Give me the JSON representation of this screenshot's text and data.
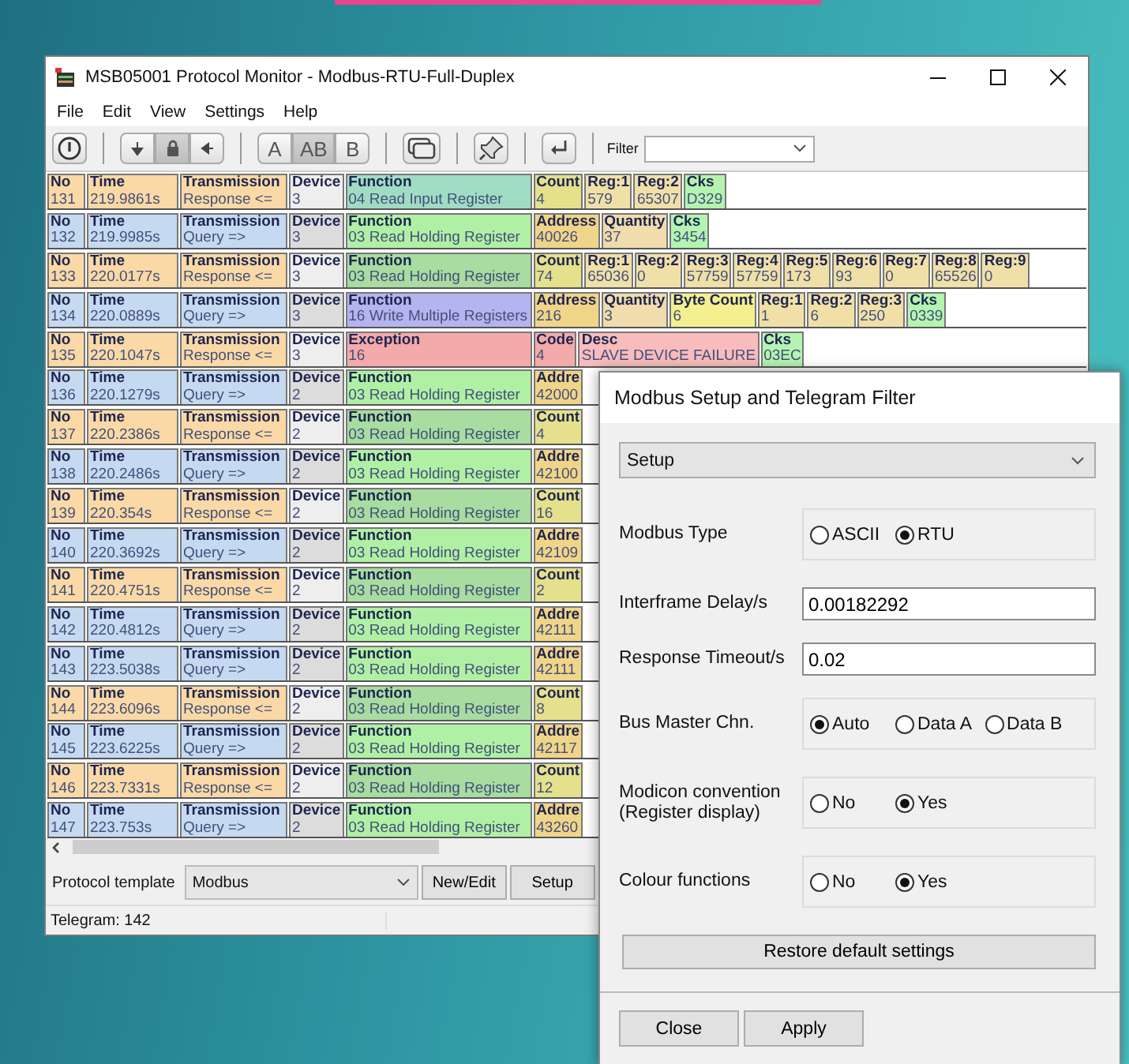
{
  "window": {
    "title": "MSB05001 Protocol Monitor - Modbus-RTU-Full-Duplex",
    "menu": [
      "File",
      "Edit",
      "View",
      "Settings",
      "Help"
    ],
    "toolbar": {
      "scroll_buttons": [
        {
          "selected": false
        },
        {
          "selected": true
        },
        {
          "selected": false
        }
      ],
      "view_buttons": [
        {
          "label": "A",
          "selected": false
        },
        {
          "label": "AB",
          "selected": true
        },
        {
          "label": "B",
          "selected": false
        }
      ],
      "filter_label": "Filter"
    }
  },
  "telegrams": [
    {
      "cells": [
        {
          "label": "No",
          "value": "131",
          "color": "#fad9a6"
        },
        {
          "label": "Time",
          "value": "219.9861s",
          "color": "#fad9a6"
        },
        {
          "label": "Transmission",
          "value": "Response <=",
          "color": "#fad9a6"
        },
        {
          "label": "Device",
          "value": "3",
          "color": "#eeeeee"
        },
        {
          "label": "Function",
          "value": "04 Read Input Register",
          "color": "#a0dcc4"
        },
        {
          "label": "Count",
          "value": "4",
          "color": "#e4e08c"
        },
        {
          "label": "Reg:1",
          "value": "579",
          "color": "#f0e0a8"
        },
        {
          "label": "Reg:2",
          "value": "65307",
          "color": "#f0e0a8"
        },
        {
          "label": "Cks",
          "value": "D329",
          "color": "#b4f4b0"
        }
      ]
    },
    {
      "cells": [
        {
          "label": "No",
          "value": "132",
          "color": "#c5d9f1"
        },
        {
          "label": "Time",
          "value": "219.9985s",
          "color": "#c5d9f1"
        },
        {
          "label": "Transmission",
          "value": "Query =>",
          "color": "#c5d9f1"
        },
        {
          "label": "Device",
          "value": "3",
          "color": "#dcdcdc"
        },
        {
          "label": "Function",
          "value": "03 Read Holding Register",
          "color": "#b0f0a4"
        },
        {
          "label": "Address",
          "value": "40026",
          "color": "#f0d488"
        },
        {
          "label": "Quantity",
          "value": "37",
          "color": "#f0dcac"
        },
        {
          "label": "Cks",
          "value": "3454",
          "color": "#b4f4b0"
        }
      ]
    },
    {
      "cells": [
        {
          "label": "No",
          "value": "133",
          "color": "#fad9a6"
        },
        {
          "label": "Time",
          "value": "220.0177s",
          "color": "#fad9a6"
        },
        {
          "label": "Transmission",
          "value": "Response <=",
          "color": "#fad9a6"
        },
        {
          "label": "Device",
          "value": "3",
          "color": "#eeeeee"
        },
        {
          "label": "Function",
          "value": "03 Read Holding Register",
          "color": "#a8dca0"
        },
        {
          "label": "Count",
          "value": "74",
          "color": "#e4e08c"
        },
        {
          "label": "Reg:1",
          "value": "65036",
          "color": "#f0e0a8"
        },
        {
          "label": "Reg:2",
          "value": "0",
          "color": "#f0e0a8"
        },
        {
          "label": "Reg:3",
          "value": "57759",
          "color": "#f0e0a8"
        },
        {
          "label": "Reg:4",
          "value": "57759",
          "color": "#f0e0a8"
        },
        {
          "label": "Reg:5",
          "value": "173",
          "color": "#f0e0a8"
        },
        {
          "label": "Reg:6",
          "value": "93",
          "color": "#f0e0a8"
        },
        {
          "label": "Reg:7",
          "value": "0",
          "color": "#f0e0a8"
        },
        {
          "label": "Reg:8",
          "value": "65526",
          "color": "#f0e0a8"
        },
        {
          "label": "Reg:9",
          "value": "0",
          "color": "#f0e0a8"
        }
      ]
    },
    {
      "cells": [
        {
          "label": "No",
          "value": "134",
          "color": "#c5d9f1"
        },
        {
          "label": "Time",
          "value": "220.0889s",
          "color": "#c5d9f1"
        },
        {
          "label": "Transmission",
          "value": "Query =>",
          "color": "#c5d9f1"
        },
        {
          "label": "Device",
          "value": "3",
          "color": "#dcdcdc"
        },
        {
          "label": "Function",
          "value": "16 Write Multiple Registers",
          "color": "#b4b4f0"
        },
        {
          "label": "Address",
          "value": "216",
          "color": "#f0d488"
        },
        {
          "label": "Quantity",
          "value": "3",
          "color": "#f0dcac"
        },
        {
          "label": "Byte Count",
          "value": "6",
          "color": "#f4f090"
        },
        {
          "label": "Reg:1",
          "value": "1",
          "color": "#f0e0a8"
        },
        {
          "label": "Reg:2",
          "value": "6",
          "color": "#f0e0a8"
        },
        {
          "label": "Reg:3",
          "value": "250",
          "color": "#f0e0a8"
        },
        {
          "label": "Cks",
          "value": "0339",
          "color": "#b4f4b0"
        }
      ]
    },
    {
      "cells": [
        {
          "label": "No",
          "value": "135",
          "color": "#fad9a6"
        },
        {
          "label": "Time",
          "value": "220.1047s",
          "color": "#fad9a6"
        },
        {
          "label": "Transmission",
          "value": "Response <=",
          "color": "#fad9a6"
        },
        {
          "label": "Device",
          "value": "3",
          "color": "#eeeeee"
        },
        {
          "label": "Exception",
          "value": "16",
          "color": "#f4aaaa"
        },
        {
          "label": "Code",
          "value": "4",
          "color": "#f4aaaa"
        },
        {
          "label": "Desc",
          "value": "SLAVE DEVICE FAILURE",
          "color": "#f8bcbc"
        },
        {
          "label": "Cks",
          "value": "03EC",
          "color": "#b4f4b0"
        }
      ]
    },
    {
      "cells": [
        {
          "label": "No",
          "value": "136",
          "color": "#c5d9f1"
        },
        {
          "label": "Time",
          "value": "220.1279s",
          "color": "#c5d9f1"
        },
        {
          "label": "Transmission",
          "value": "Query =>",
          "color": "#c5d9f1"
        },
        {
          "label": "Device",
          "value": "2",
          "color": "#dcdcdc"
        },
        {
          "label": "Function",
          "value": "03 Read Holding Register",
          "color": "#b0f0a4"
        },
        {
          "label": "Addre",
          "value": "42000",
          "color": "#f0d488"
        }
      ]
    },
    {
      "cells": [
        {
          "label": "No",
          "value": "137",
          "color": "#fad9a6"
        },
        {
          "label": "Time",
          "value": "220.2386s",
          "color": "#fad9a6"
        },
        {
          "label": "Transmission",
          "value": "Response <=",
          "color": "#fad9a6"
        },
        {
          "label": "Device",
          "value": "2",
          "color": "#eeeeee"
        },
        {
          "label": "Function",
          "value": "03 Read Holding Register",
          "color": "#a8dca0"
        },
        {
          "label": "Count",
          "value": "4",
          "color": "#e4e08c"
        }
      ]
    },
    {
      "cells": [
        {
          "label": "No",
          "value": "138",
          "color": "#c5d9f1"
        },
        {
          "label": "Time",
          "value": "220.2486s",
          "color": "#c5d9f1"
        },
        {
          "label": "Transmission",
          "value": "Query =>",
          "color": "#c5d9f1"
        },
        {
          "label": "Device",
          "value": "2",
          "color": "#dcdcdc"
        },
        {
          "label": "Function",
          "value": "03 Read Holding Register",
          "color": "#b0f0a4"
        },
        {
          "label": "Addre",
          "value": "42100",
          "color": "#f0d488"
        }
      ]
    },
    {
      "cells": [
        {
          "label": "No",
          "value": "139",
          "color": "#fad9a6"
        },
        {
          "label": "Time",
          "value": "220.354s",
          "color": "#fad9a6"
        },
        {
          "label": "Transmission",
          "value": "Response <=",
          "color": "#fad9a6"
        },
        {
          "label": "Device",
          "value": "2",
          "color": "#eeeeee"
        },
        {
          "label": "Function",
          "value": "03 Read Holding Register",
          "color": "#a8dca0"
        },
        {
          "label": "Count",
          "value": "16",
          "color": "#e4e08c"
        }
      ]
    },
    {
      "cells": [
        {
          "label": "No",
          "value": "140",
          "color": "#c5d9f1"
        },
        {
          "label": "Time",
          "value": "220.3692s",
          "color": "#c5d9f1"
        },
        {
          "label": "Transmission",
          "value": "Query =>",
          "color": "#c5d9f1"
        },
        {
          "label": "Device",
          "value": "2",
          "color": "#dcdcdc"
        },
        {
          "label": "Function",
          "value": "03 Read Holding Register",
          "color": "#b0f0a4"
        },
        {
          "label": "Addre",
          "value": "42109",
          "color": "#f0d488"
        }
      ]
    },
    {
      "cells": [
        {
          "label": "No",
          "value": "141",
          "color": "#fad9a6"
        },
        {
          "label": "Time",
          "value": "220.4751s",
          "color": "#fad9a6"
        },
        {
          "label": "Transmission",
          "value": "Response <=",
          "color": "#fad9a6"
        },
        {
          "label": "Device",
          "value": "2",
          "color": "#eeeeee"
        },
        {
          "label": "Function",
          "value": "03 Read Holding Register",
          "color": "#a8dca0"
        },
        {
          "label": "Count",
          "value": "2",
          "color": "#e4e08c"
        }
      ]
    },
    {
      "cells": [
        {
          "label": "No",
          "value": "142",
          "color": "#c5d9f1"
        },
        {
          "label": "Time",
          "value": "220.4812s",
          "color": "#c5d9f1"
        },
        {
          "label": "Transmission",
          "value": "Query =>",
          "color": "#c5d9f1"
        },
        {
          "label": "Device",
          "value": "2",
          "color": "#dcdcdc"
        },
        {
          "label": "Function",
          "value": "03 Read Holding Register",
          "color": "#b0f0a4"
        },
        {
          "label": "Addre",
          "value": "42111",
          "color": "#f0d488"
        }
      ]
    },
    {
      "cells": [
        {
          "label": "No",
          "value": "143",
          "color": "#c5d9f1"
        },
        {
          "label": "Time",
          "value": "223.5038s",
          "color": "#c5d9f1"
        },
        {
          "label": "Transmission",
          "value": "Query =>",
          "color": "#c5d9f1"
        },
        {
          "label": "Device",
          "value": "2",
          "color": "#dcdcdc"
        },
        {
          "label": "Function",
          "value": "03 Read Holding Register",
          "color": "#b0f0a4"
        },
        {
          "label": "Addre",
          "value": "42111",
          "color": "#f0d488"
        }
      ]
    },
    {
      "cells": [
        {
          "label": "No",
          "value": "144",
          "color": "#fad9a6"
        },
        {
          "label": "Time",
          "value": "223.6096s",
          "color": "#fad9a6"
        },
        {
          "label": "Transmission",
          "value": "Response <=",
          "color": "#fad9a6"
        },
        {
          "label": "Device",
          "value": "2",
          "color": "#eeeeee"
        },
        {
          "label": "Function",
          "value": "03 Read Holding Register",
          "color": "#a8dca0"
        },
        {
          "label": "Count",
          "value": "8",
          "color": "#e4e08c"
        }
      ]
    },
    {
      "cells": [
        {
          "label": "No",
          "value": "145",
          "color": "#c5d9f1"
        },
        {
          "label": "Time",
          "value": "223.6225s",
          "color": "#c5d9f1"
        },
        {
          "label": "Transmission",
          "value": "Query =>",
          "color": "#c5d9f1"
        },
        {
          "label": "Device",
          "value": "2",
          "color": "#dcdcdc"
        },
        {
          "label": "Function",
          "value": "03 Read Holding Register",
          "color": "#b0f0a4"
        },
        {
          "label": "Addre",
          "value": "42117",
          "color": "#f0d488"
        }
      ]
    },
    {
      "cells": [
        {
          "label": "No",
          "value": "146",
          "color": "#fad9a6"
        },
        {
          "label": "Time",
          "value": "223.7331s",
          "color": "#fad9a6"
        },
        {
          "label": "Transmission",
          "value": "Response <=",
          "color": "#fad9a6"
        },
        {
          "label": "Device",
          "value": "2",
          "color": "#eeeeee"
        },
        {
          "label": "Function",
          "value": "03 Read Holding Register",
          "color": "#a8dca0"
        },
        {
          "label": "Count",
          "value": "12",
          "color": "#e4e08c"
        }
      ]
    },
    {
      "cells": [
        {
          "label": "No",
          "value": "147",
          "color": "#c5d9f1"
        },
        {
          "label": "Time",
          "value": "223.753s",
          "color": "#c5d9f1"
        },
        {
          "label": "Transmission",
          "value": "Query =>",
          "color": "#c5d9f1"
        },
        {
          "label": "Device",
          "value": "2",
          "color": "#dcdcdc"
        },
        {
          "label": "Function",
          "value": "03 Read Holding Register",
          "color": "#b0f0a4"
        },
        {
          "label": "Addre",
          "value": "43260",
          "color": "#f0d488"
        }
      ]
    }
  ],
  "bottom_bar": {
    "template_label": "Protocol template",
    "template_value": "Modbus",
    "buttons": [
      "New/Edit",
      "Setup"
    ]
  },
  "status_bar": "Telegram: 142",
  "dialog": {
    "title": "Modbus Setup and Telegram Filter",
    "section": "Setup",
    "settings": [
      {
        "kind": "radio",
        "label": "Modbus Type",
        "options": [
          {
            "label": "ASCII",
            "selected": false
          },
          {
            "label": "RTU",
            "selected": true
          }
        ]
      },
      {
        "kind": "input",
        "label": "Interframe Delay/s",
        "value": "0.00182292"
      },
      {
        "kind": "input",
        "label": "Response Timeout/s",
        "value": "0.02"
      },
      {
        "kind": "radio",
        "label": "Bus Master Chn.",
        "options": [
          {
            "label": "Auto",
            "selected": true
          },
          {
            "label": "Data A",
            "selected": false
          },
          {
            "label": "Data B",
            "selected": false
          }
        ]
      },
      {
        "kind": "radio",
        "label": "Modicon convention (Register display)",
        "options": [
          {
            "label": "No",
            "selected": false
          },
          {
            "label": "Yes",
            "selected": true
          }
        ]
      },
      {
        "kind": "radio",
        "label": "Colour functions",
        "options": [
          {
            "label": "No",
            "selected": false
          },
          {
            "label": "Yes",
            "selected": true
          }
        ]
      }
    ],
    "restore_button": "Restore default settings",
    "buttons": [
      "Close",
      "Apply"
    ]
  }
}
